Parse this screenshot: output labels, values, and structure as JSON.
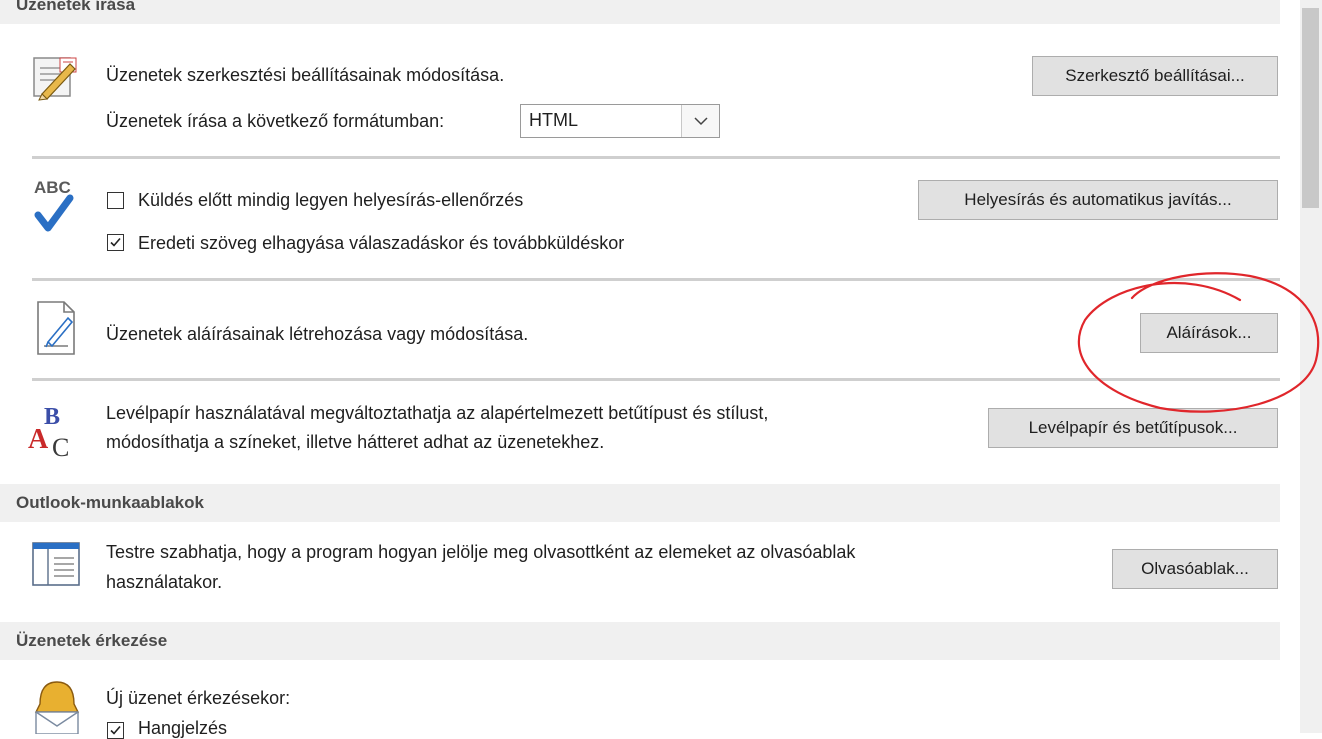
{
  "sections": {
    "compose": {
      "header": "Üzenetek írása"
    },
    "panes": {
      "header": "Outlook-munkaablakok"
    },
    "arrival": {
      "header": "Üzenetek érkezése"
    }
  },
  "compose": {
    "editor_text": "Üzenetek szerkesztési beállításainak módosítása.",
    "editor_button": "Szerkesztő beállításai...",
    "format_label": "Üzenetek írása a következő formátumban:",
    "format_value": "HTML"
  },
  "spelling": {
    "icon_label": "ABC",
    "check1_label": "Küldés előtt mindig legyen helyesírás-ellenőrzés",
    "check1_checked": false,
    "check2_label": "Eredeti szöveg elhagyása válaszadáskor és továbbküldéskor",
    "check2_checked": true,
    "button": "Helyesírás és automatikus javítás..."
  },
  "signatures": {
    "text": "Üzenetek aláírásainak létrehozása vagy módosítása.",
    "button": "Aláírások..."
  },
  "stationery": {
    "line1": "Levélpapír használatával megváltoztathatja az alapértelmezett betűtípust és stílust,",
    "line2": "módosíthatja a színeket, illetve hátteret adhat az üzenetekhez.",
    "button": "Levélpapír és betűtípusok..."
  },
  "panes": {
    "line1": "Testre szabhatja, hogy a program hogyan jelölje meg olvasottként az elemeket az olvasóablak",
    "line2": "használatakor.",
    "button": "Olvasóablak..."
  },
  "arrival": {
    "text": "Új üzenet érkezésekor:",
    "check_label": "Hangjelzés",
    "check_checked": true
  },
  "colors": {
    "annotation": "#e0262b",
    "check_blue": "#2a6fc4",
    "button_bg": "#e1e1e1"
  }
}
